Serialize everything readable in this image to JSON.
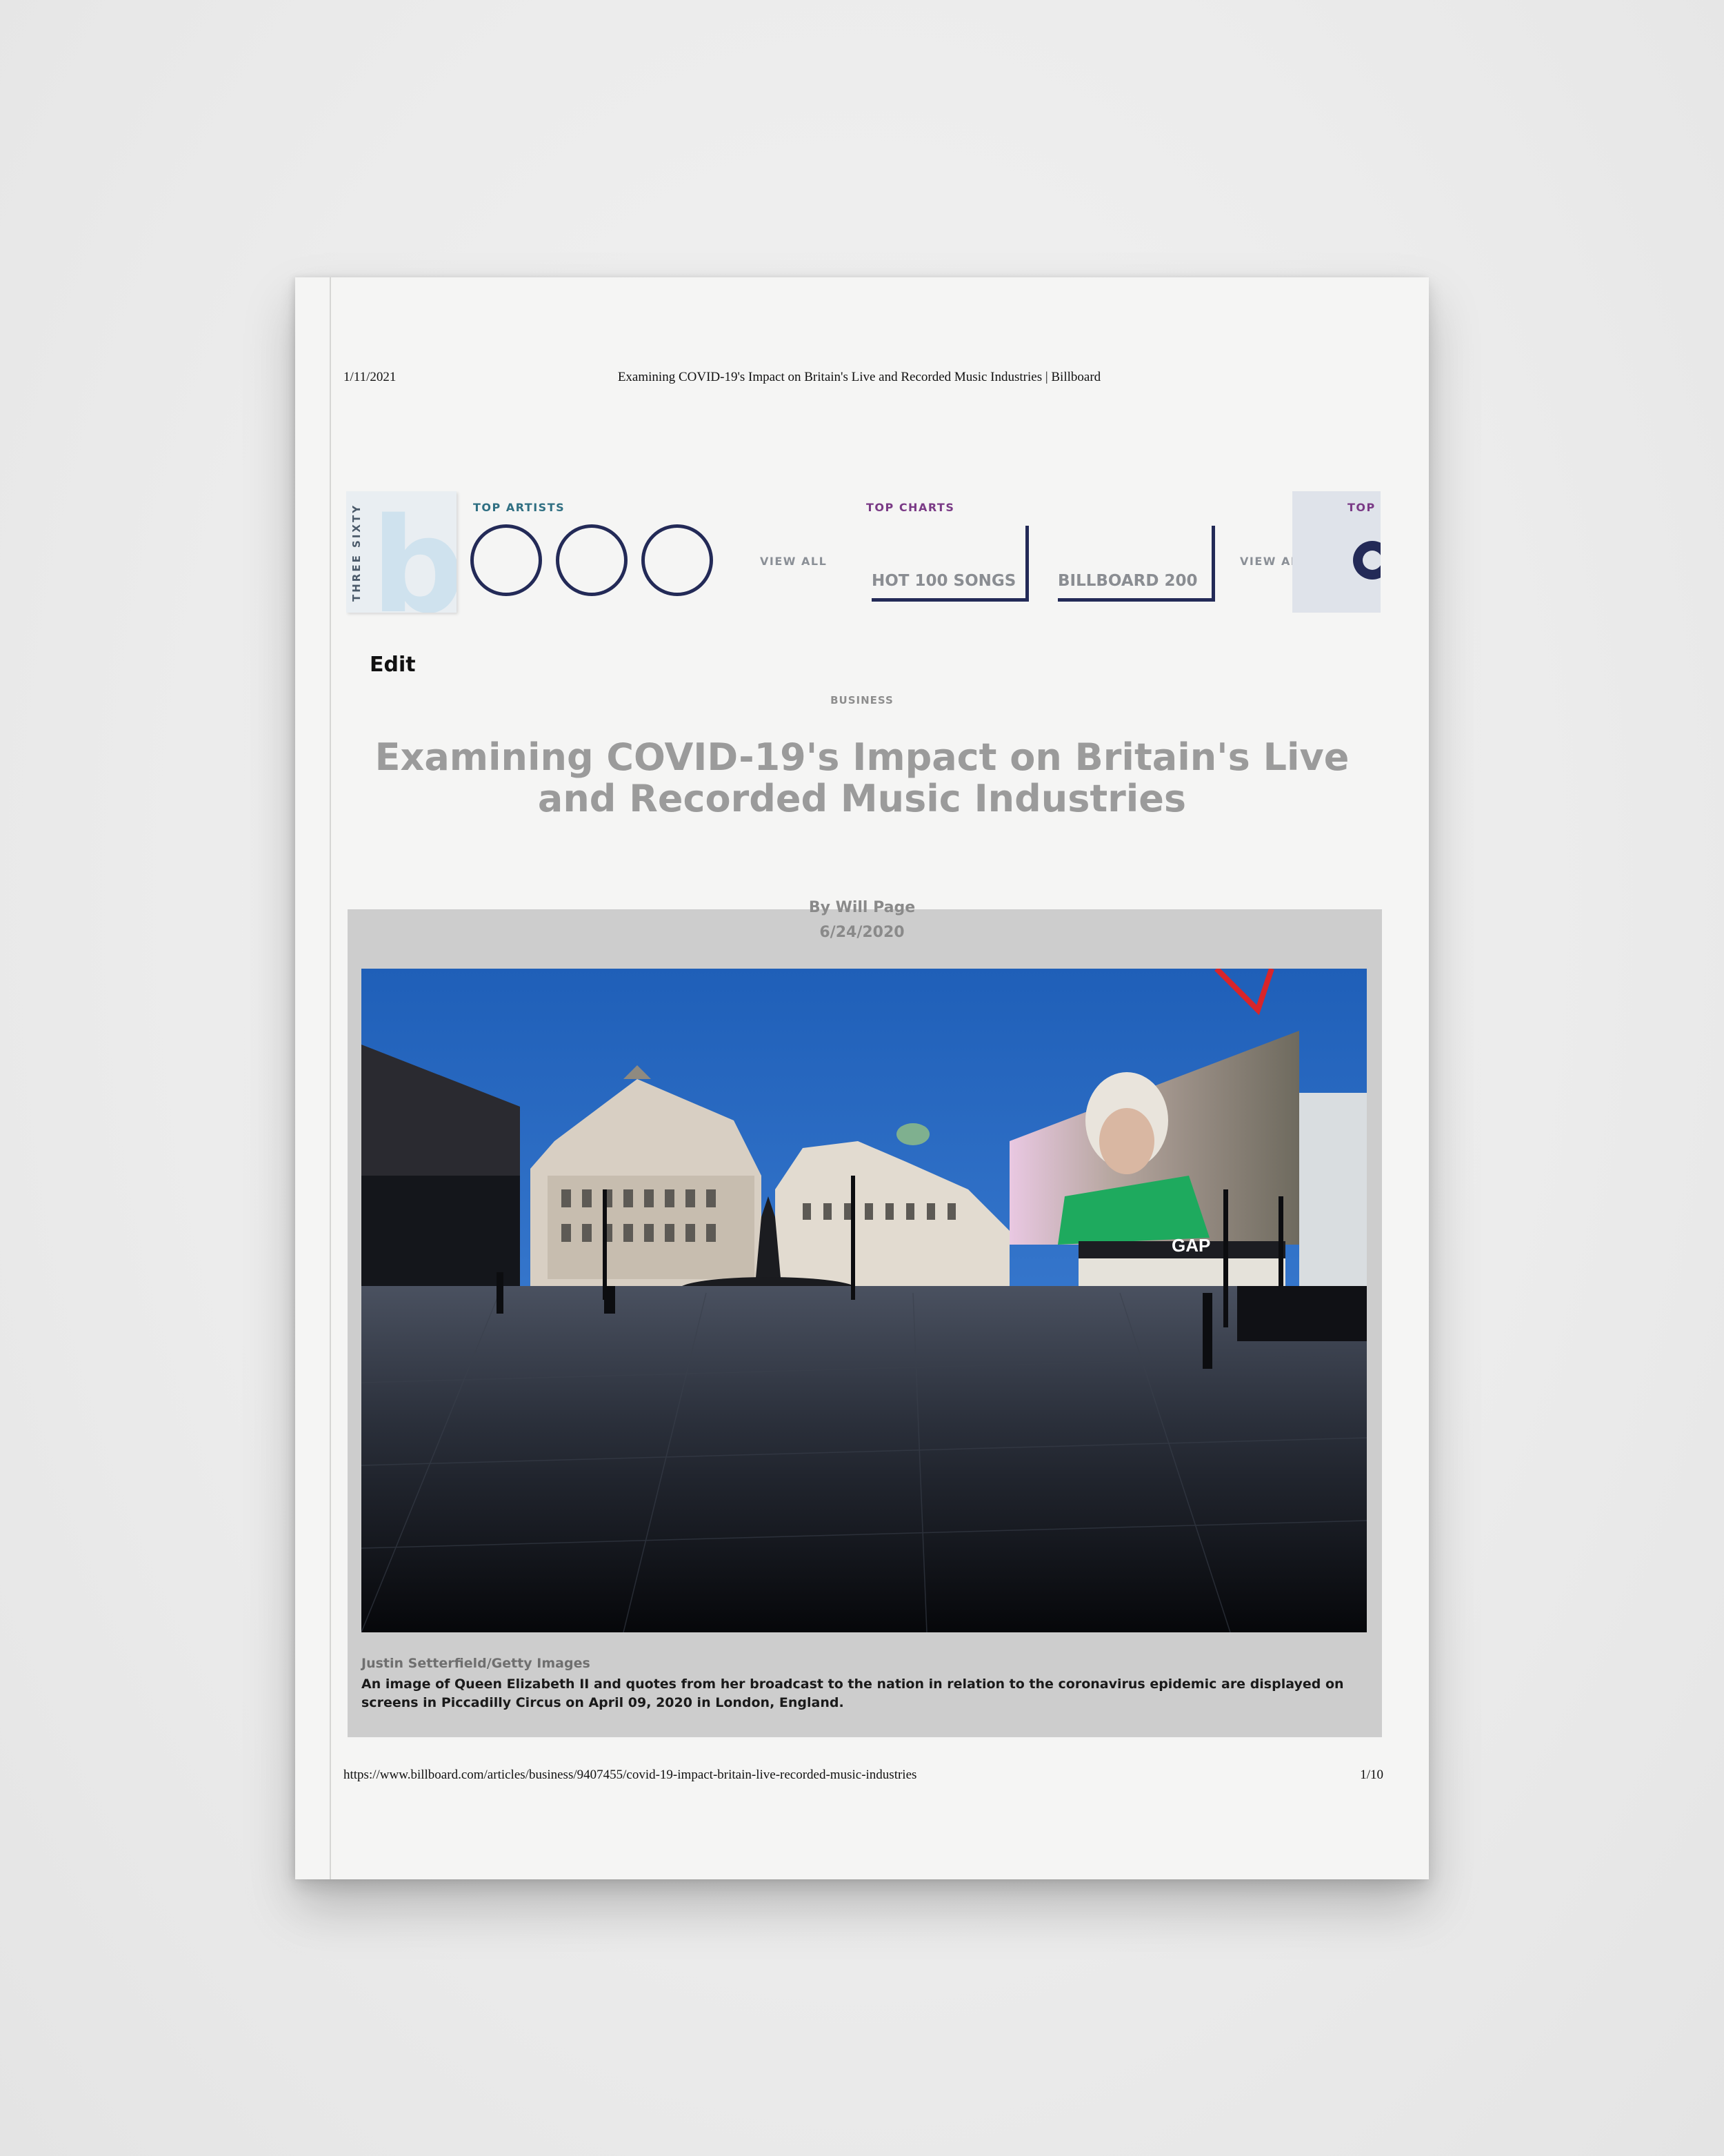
{
  "print_header": {
    "date": "1/11/2021",
    "title": "Examining COVID-19's Impact on Britain's Live and Recorded Music Industries | Billboard"
  },
  "nav": {
    "logo_side_text": "THREE SIXTY",
    "logo_letter": "b",
    "top_artists_label": "TOP ARTISTS",
    "artists_view_all": "VIEW ALL",
    "top_charts_label": "TOP CHARTS",
    "charts": [
      {
        "label": "HOT 100 SONGS"
      },
      {
        "label": "BILLBOARD 200"
      }
    ],
    "charts_view_all": "VIEW ALL",
    "truncated_label": "TOP",
    "accent_color": "#232a57"
  },
  "article": {
    "edit_label": "Edit",
    "kicker": "BUSINESS",
    "headline": "Examining COVID-19's Impact on Britain's Live and Recorded Music Industries",
    "byline": "By Will Page",
    "date": "6/24/2020",
    "photo_credit": "Justin Setterfield/Getty Images",
    "photo_caption": "An image of Queen Elizabeth II and quotes from her broadcast to the nation in relation to the coronavirus epidemic are displayed on screens in Piccadilly Circus on April 09, 2020 in London, England.",
    "photo_billboard_text": "GAP"
  },
  "print_footer": {
    "url": "https://www.billboard.com/articles/business/9407455/covid-19-impact-britain-live-recorded-music-industries",
    "page": "1/10"
  }
}
